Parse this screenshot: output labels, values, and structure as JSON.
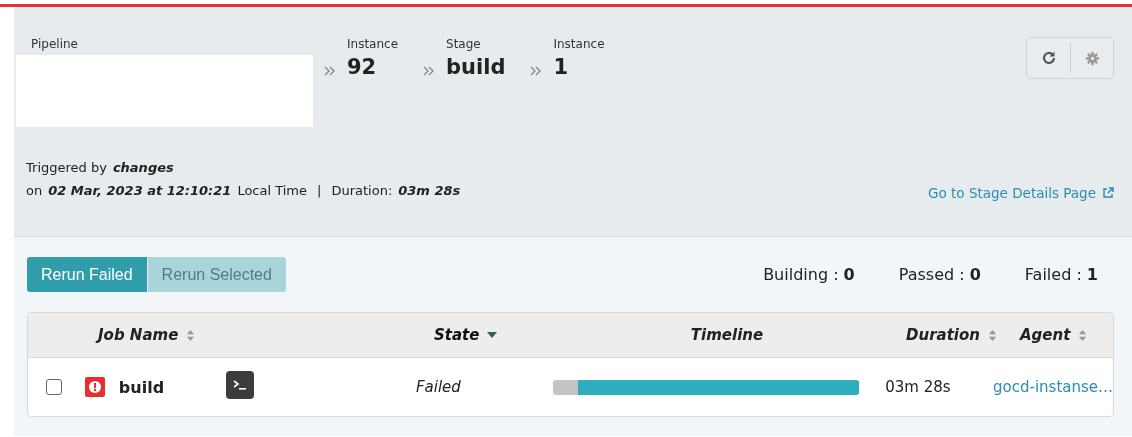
{
  "header": {
    "pipeline_label": "Pipeline",
    "crumbs": [
      {
        "label": "Instance",
        "value": "92"
      },
      {
        "label": "Stage",
        "value": "build"
      },
      {
        "label": "Instance",
        "value": "1"
      }
    ],
    "triggered_prefix": "Triggered by",
    "triggered_by": "changes",
    "on_prefix": "on",
    "date": "02 Mar, 2023 at 12:10:21",
    "time_suffix": "Local Time",
    "separator": "|",
    "duration_label": "Duration:",
    "duration": "03m 28s",
    "details_link": "Go to Stage Details Page"
  },
  "actions": [
    {
      "label": "Rerun Failed",
      "disabled": false
    },
    {
      "label": "Rerun Selected",
      "disabled": true
    }
  ],
  "counts": [
    {
      "label": "Building :",
      "value": "0"
    },
    {
      "label": "Passed :",
      "value": "0"
    },
    {
      "label": "Failed :",
      "value": "1"
    }
  ],
  "table": {
    "columns": [
      {
        "label": "Job Name",
        "sortable": true,
        "sorted": false
      },
      {
        "label": "State",
        "sortable": true,
        "sorted": true
      },
      {
        "label": "Timeline",
        "sortable": false,
        "sorted": false
      },
      {
        "label": "Duration",
        "sortable": true,
        "sorted": false
      },
      {
        "label": "Agent",
        "sortable": true,
        "sorted": false
      }
    ],
    "rows": [
      {
        "checked": false,
        "kind": "failed",
        "name": "build",
        "state": "Failed",
        "level": 0.92,
        "duration": "03m 28s",
        "agent": "gocd-instanse…"
      }
    ]
  }
}
